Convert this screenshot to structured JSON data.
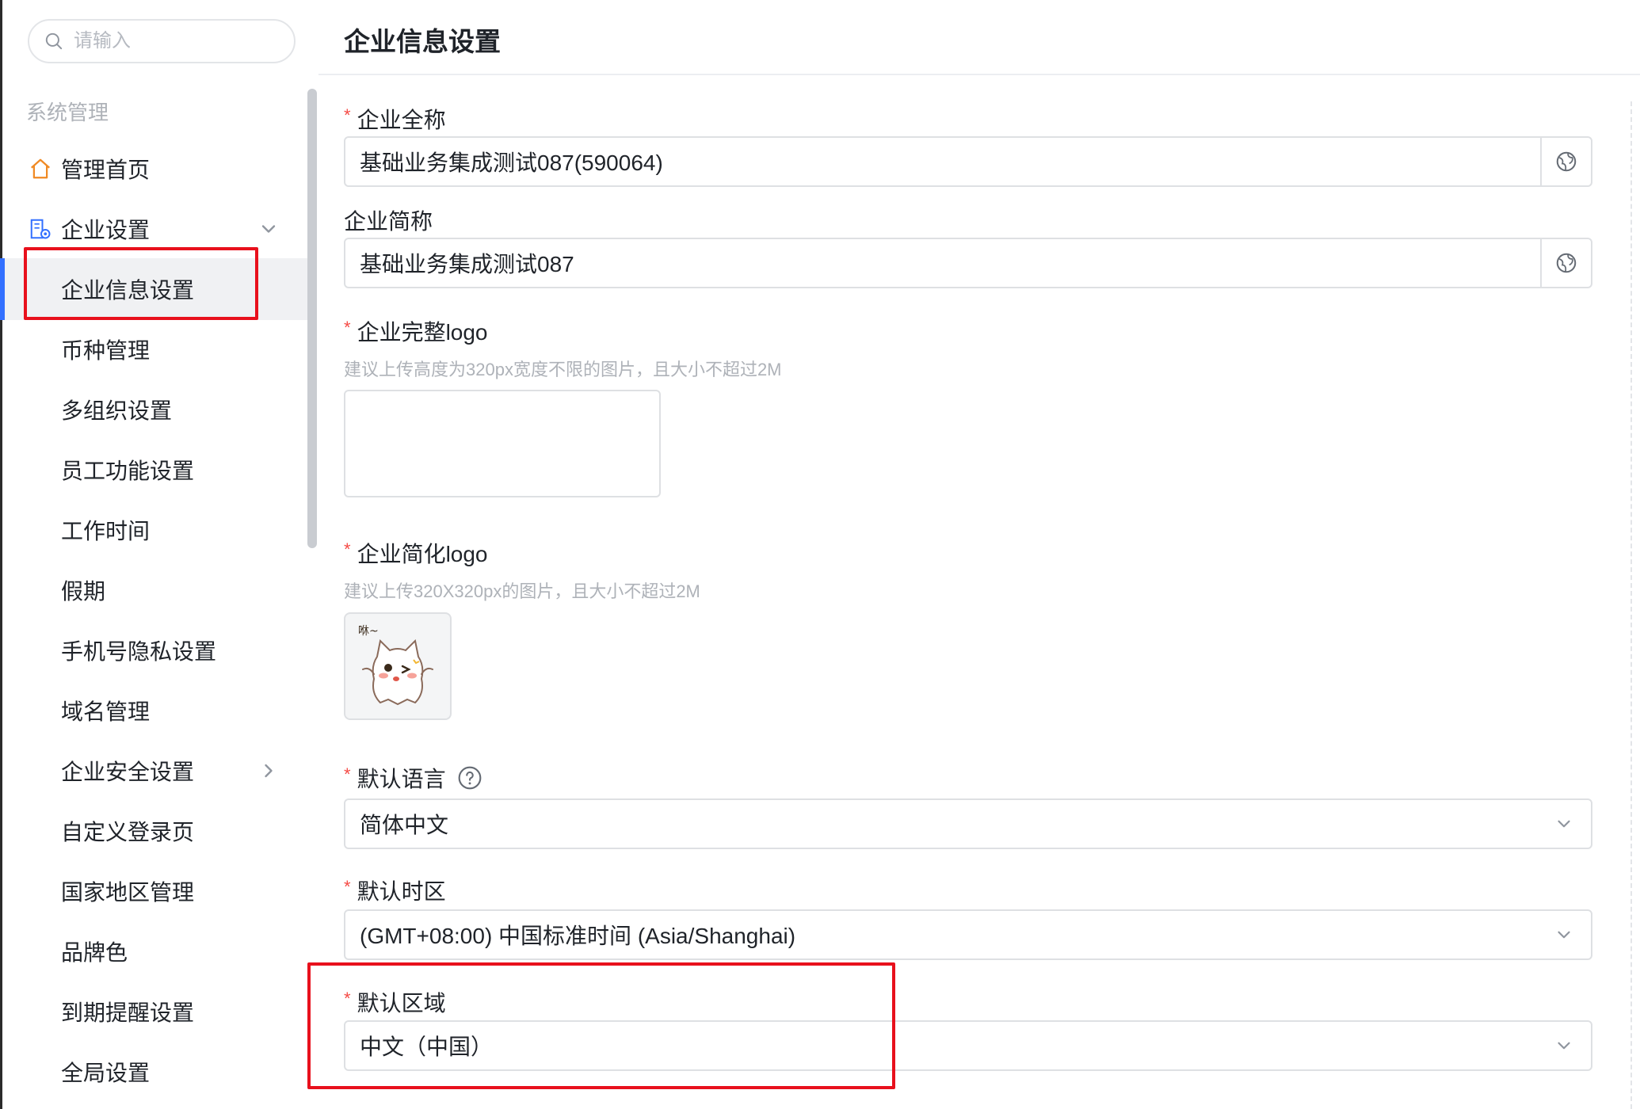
{
  "search": {
    "placeholder": "请输入"
  },
  "sidebar": {
    "section_title": "系统管理",
    "items": [
      {
        "label": "管理首页",
        "icon": "home-icon"
      },
      {
        "label": "企业设置",
        "icon": "enterprise-settings-icon",
        "expanded": true
      },
      {
        "label": "企业信息设置",
        "active": true
      },
      {
        "label": "币种管理"
      },
      {
        "label": "多组织设置"
      },
      {
        "label": "员工功能设置"
      },
      {
        "label": "工作时间"
      },
      {
        "label": "假期"
      },
      {
        "label": "手机号隐私设置"
      },
      {
        "label": "域名管理"
      },
      {
        "label": "企业安全设置",
        "has_children": true
      },
      {
        "label": "自定义登录页"
      },
      {
        "label": "国家地区管理"
      },
      {
        "label": "品牌色"
      },
      {
        "label": "到期提醒设置"
      },
      {
        "label": "全局设置"
      }
    ]
  },
  "main": {
    "title": "企业信息设置",
    "full_name": {
      "label": "企业全称",
      "required": true,
      "value": "基础业务集成测试087(590064)"
    },
    "short_name": {
      "label": "企业简称",
      "required": false,
      "value": "基础业务集成测试087"
    },
    "full_logo": {
      "label": "企业完整logo",
      "required": true,
      "hint": "建议上传高度为320px宽度不限的图片，且大小不超过2M"
    },
    "simple_logo": {
      "label": "企业简化logo",
      "required": true,
      "hint": "建议上传320X320px的图片，且大小不超过2M",
      "image_text": "咻~"
    },
    "language": {
      "label": "默认语言",
      "required": true,
      "value": "简体中文"
    },
    "timezone": {
      "label": "默认时区",
      "required": true,
      "value": "(GMT+08:00) 中国标准时间 (Asia/Shanghai)"
    },
    "region": {
      "label": "默认区域",
      "required": true,
      "value": "中文（中国）"
    },
    "required_mark": "*"
  },
  "colors": {
    "accent": "#3370ff",
    "required": "#f54a45",
    "highlight": "#e8101c"
  }
}
